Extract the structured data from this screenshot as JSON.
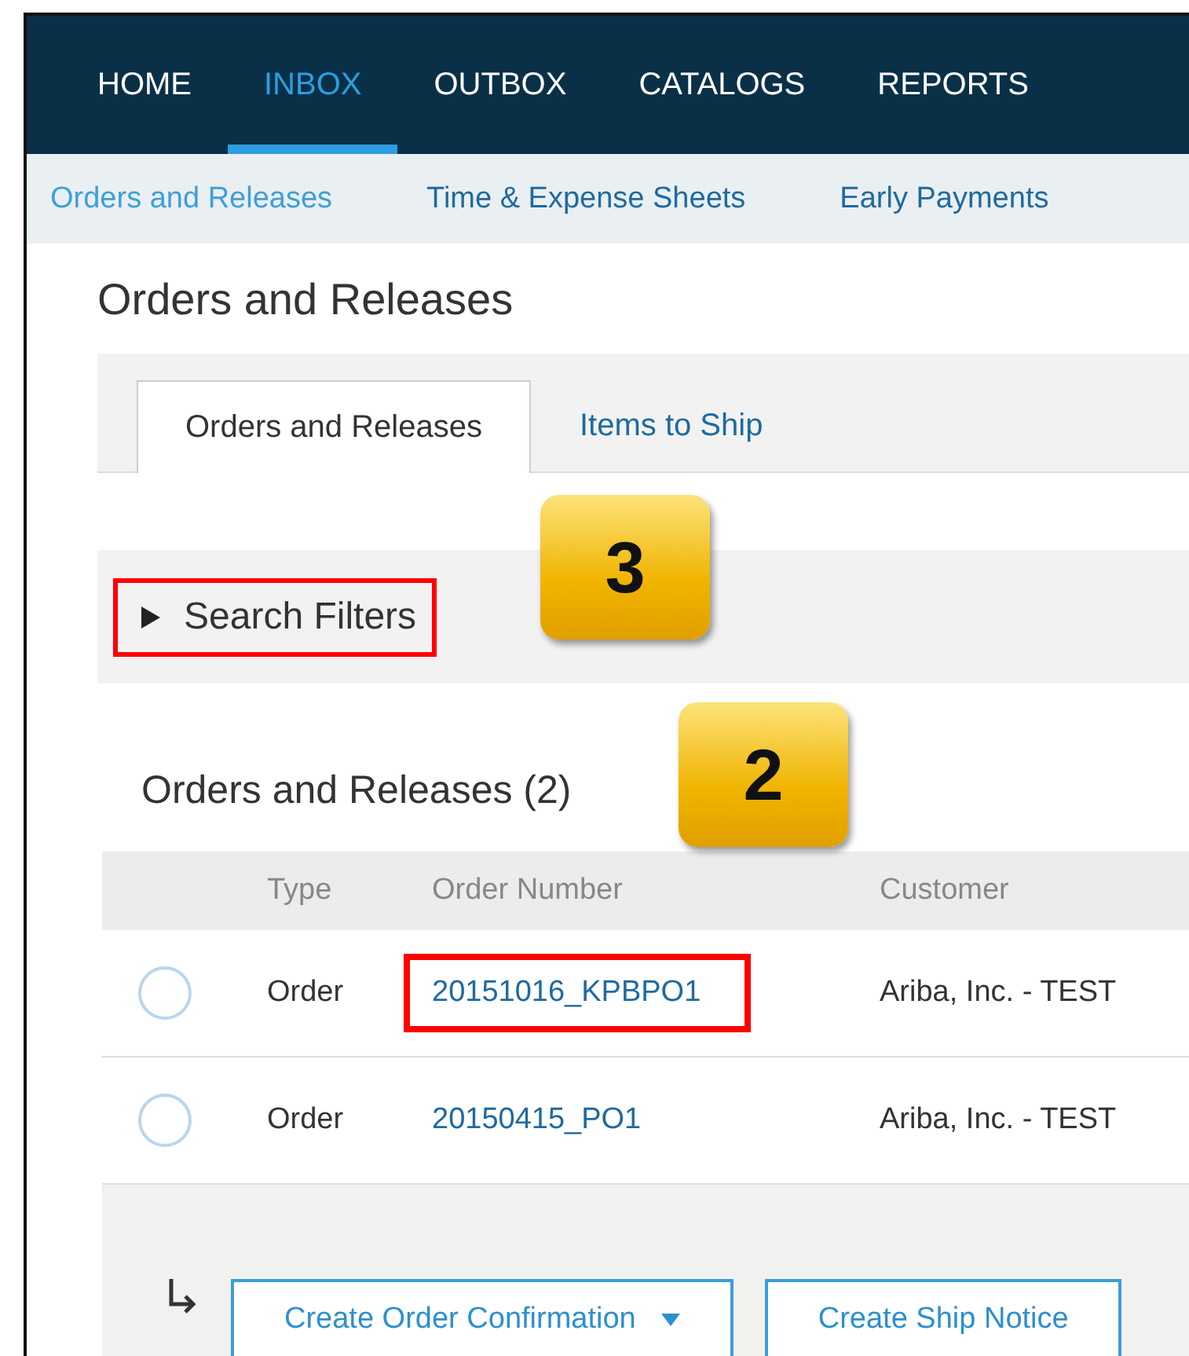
{
  "nav": {
    "items": [
      {
        "label": "HOME",
        "selected": false
      },
      {
        "label": "INBOX",
        "selected": true
      },
      {
        "label": "OUTBOX",
        "selected": false
      },
      {
        "label": "CATALOGS",
        "selected": false
      },
      {
        "label": "REPORTS",
        "selected": false
      }
    ]
  },
  "subnav": {
    "items": [
      {
        "label": "Orders and Releases",
        "selected": true
      },
      {
        "label": "Time & Expense Sheets",
        "selected": false
      },
      {
        "label": "Early Payments",
        "selected": false
      }
    ]
  },
  "page_title": "Orders and Releases",
  "tabs": [
    {
      "label": "Orders and Releases",
      "selected": true
    },
    {
      "label": "Items to Ship",
      "selected": false
    }
  ],
  "search_filters": {
    "label": "Search Filters",
    "expanded": false,
    "highlighted": true,
    "callout": "3"
  },
  "table": {
    "title": "Orders and Releases (2)",
    "callout": "2",
    "columns": [
      "Type",
      "Order Number",
      "Customer"
    ],
    "rows": [
      {
        "selected": false,
        "type": "Order",
        "order_number": "20151016_KPBPO1",
        "highlighted": true,
        "customer": "Ariba, Inc. - TEST"
      },
      {
        "selected": false,
        "type": "Order",
        "order_number": "20150415_PO1",
        "highlighted": false,
        "customer": "Ariba, Inc. - TEST"
      }
    ]
  },
  "actions": [
    {
      "label": "Create Order Confirmation",
      "dropdown": true
    },
    {
      "label": "Create Ship Notice",
      "dropdown": false
    }
  ]
}
